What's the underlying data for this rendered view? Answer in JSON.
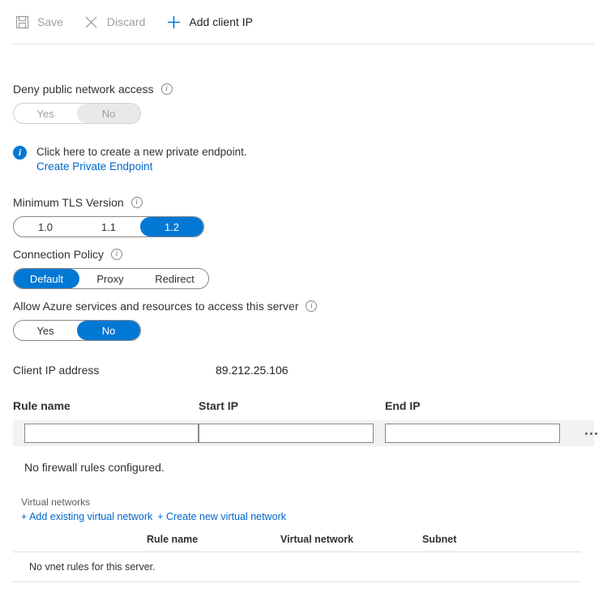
{
  "toolbar": {
    "items": [
      {
        "label": "Save",
        "icon": "save-icon",
        "enabled": false
      },
      {
        "label": "Discard",
        "icon": "close-icon",
        "enabled": false
      },
      {
        "label": "Add client IP",
        "icon": "plus-icon",
        "enabled": true
      }
    ],
    "save_label": "Save",
    "discard_label": "Discard",
    "add_client_ip_label": "Add client IP"
  },
  "deny_public_network_access": {
    "label": "Deny public network access",
    "options": [
      "Yes",
      "No"
    ],
    "yes_label": "Yes",
    "no_label": "No",
    "selected": "No",
    "disabled": true
  },
  "private_endpoint_banner": {
    "message": "Click here to create a new private endpoint.",
    "link_label": "Create Private Endpoint"
  },
  "minimum_tls_version": {
    "label": "Minimum TLS Version",
    "options": [
      "1.0",
      "1.1",
      "1.2"
    ],
    "option_1": "1.0",
    "option_2": "1.1",
    "option_3": "1.2",
    "selected": "1.2"
  },
  "connection_policy": {
    "label": "Connection Policy",
    "options": [
      "Default",
      "Proxy",
      "Redirect"
    ],
    "option_default": "Default",
    "option_proxy": "Proxy",
    "option_redirect": "Redirect",
    "selected": "Default"
  },
  "allow_azure_services": {
    "label": "Allow Azure services and resources to access this server",
    "options": [
      "Yes",
      "No"
    ],
    "yes_label": "Yes",
    "no_label": "No",
    "selected": "No"
  },
  "client_ip": {
    "label": "Client IP address",
    "value": "89.212.25.106"
  },
  "firewall_rules": {
    "columns": {
      "rule_name": "Rule name",
      "start_ip": "Start IP",
      "end_ip": "End IP"
    },
    "new_rule_row": {
      "rule_name_value": "",
      "start_ip_value": "",
      "end_ip_value": "",
      "menu_icon": "ellipsis-icon"
    },
    "empty_message": "No firewall rules configured."
  },
  "virtual_networks": {
    "title": "Virtual networks",
    "add_existing_label": "+ Add existing virtual network",
    "create_new_label": "+ Create new virtual network",
    "columns": {
      "rule_name": "Rule name",
      "virtual_network": "Virtual network",
      "subnet": "Subnet"
    },
    "empty_message": "No vnet rules for this server."
  },
  "colors": {
    "accent": "#0078d4",
    "link": "#0066cc",
    "disabled_text": "#a19f9d",
    "row_background": "#f3f2f1",
    "border": "#8a8886"
  }
}
